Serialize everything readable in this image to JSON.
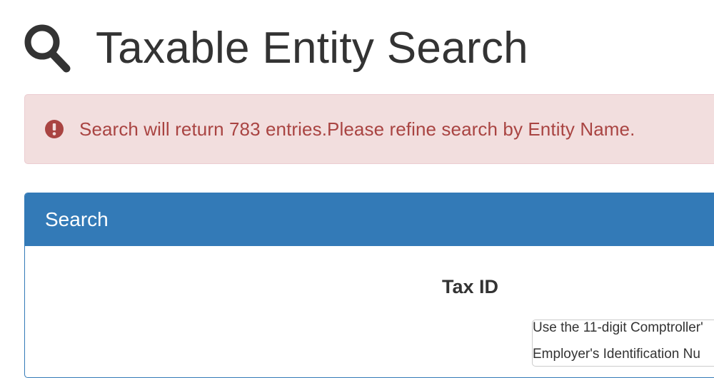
{
  "header": {
    "icon": "search-icon",
    "title": "Taxable Entity Search"
  },
  "alert": {
    "icon": "exclamation-circle-icon",
    "message": "Search will return 783 entries.Please refine search by Entity Name.",
    "color": "#a94442",
    "background": "#f2dede"
  },
  "panel": {
    "heading": "Search",
    "accent": "#337ab7",
    "tax_id": {
      "label": "Tax ID",
      "value": "",
      "help_line_1": "Use the 11-digit Comptroller'",
      "help_line_2": "Employer's Identification Nu"
    }
  }
}
